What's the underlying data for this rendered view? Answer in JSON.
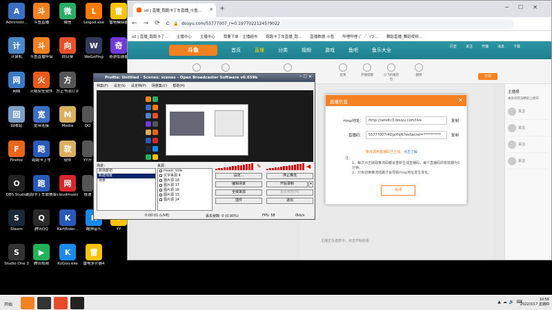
{
  "desktop": {
    "icons": [
      {
        "label": "Administr...",
        "color": "#3a6fc4",
        "glyph": "A",
        "col": 0,
        "row": 0
      },
      {
        "label": "斗鱼直播",
        "color": "#f58220",
        "glyph": "斗",
        "col": 1,
        "row": 0
      },
      {
        "label": "微信",
        "color": "#2aae67",
        "glyph": "微",
        "col": 2,
        "row": 0
      },
      {
        "label": "Leigod.exe",
        "color": "#ff7a00",
        "glyph": "L",
        "col": 3,
        "row": 0
      },
      {
        "label": "雷电模拟器",
        "color": "#f8c400",
        "glyph": "雷",
        "col": 4,
        "row": 0
      },
      {
        "label": "计算机",
        "color": "#4a86c8",
        "glyph": "计",
        "col": 0,
        "row": 1
      },
      {
        "label": "斗鱼直播伴侣",
        "color": "#f58220",
        "glyph": "斗",
        "col": 1,
        "row": 1
      },
      {
        "label": "向日葵",
        "color": "#e8502a",
        "glyph": "向",
        "col": 2,
        "row": 1
      },
      {
        "label": "WeGoPing",
        "color": "#333a5e",
        "glyph": "W",
        "col": 3,
        "row": 1
      },
      {
        "label": "奇游加速器",
        "color": "#6f3ad8",
        "glyph": "奇",
        "col": 4,
        "row": 1
      },
      {
        "label": "网络",
        "color": "#3a79c4",
        "glyph": "网",
        "col": 0,
        "row": 2
      },
      {
        "label": "火绒安全软件",
        "color": "#e85a1a",
        "glyph": "火",
        "col": 1,
        "row": 2
      },
      {
        "label": "方正书法打字",
        "color": "#555",
        "glyph": "方",
        "col": 2,
        "row": 2
      },
      {
        "label": "回收站",
        "color": "#7aa0c8",
        "glyph": "回",
        "col": 0,
        "row": 3
      },
      {
        "label": "宽带连接",
        "color": "#3a6fc4",
        "glyph": "宽",
        "col": 1,
        "row": 3
      },
      {
        "label": "Media",
        "color": "#d8b060",
        "glyph": "M",
        "col": 2,
        "row": 3
      },
      {
        "label": "Firefox",
        "color": "#e8661a",
        "glyph": "F",
        "col": 0,
        "row": 4
      },
      {
        "label": "跑跑卡丁车",
        "color": "#2a5ab8",
        "glyph": "跑",
        "col": 1,
        "row": 4
      },
      {
        "label": "软件",
        "color": "#d8b060",
        "glyph": "软",
        "col": 2,
        "row": 4
      },
      {
        "label": "OBS Studio",
        "color": "#222",
        "glyph": "O",
        "col": 0,
        "row": 5
      },
      {
        "label": "跑跑卡丁车联赛版",
        "color": "#2a5ab8",
        "glyph": "跑",
        "col": 1,
        "row": 5
      },
      {
        "label": "cloudmusic",
        "color": "#d8272a",
        "glyph": "网",
        "col": 2,
        "row": 5
      },
      {
        "label": "Steam",
        "color": "#1b2838",
        "glyph": "S",
        "col": 0,
        "row": 6
      },
      {
        "label": "腾讯QQ",
        "color": "#2a2a2a",
        "glyph": "Q",
        "col": 1,
        "row": 6
      },
      {
        "label": "KartRider...",
        "color": "#2a5ab8",
        "glyph": "K",
        "col": 2,
        "row": 6
      },
      {
        "label": "酷狗音乐",
        "color": "#1a8ae8",
        "glyph": "K",
        "col": 3,
        "row": 6
      },
      {
        "label": "YY",
        "color": "#f8c400",
        "glyph": "Y",
        "col": 4,
        "row": 6
      },
      {
        "label": "Studio One 3",
        "color": "#333",
        "glyph": "S",
        "col": 0,
        "row": 7
      },
      {
        "label": "腾讯视频",
        "color": "#21b35a",
        "glyph": "▶",
        "col": 1,
        "row": 7
      },
      {
        "label": "KuGou.exe",
        "color": "#1a8ae8",
        "glyph": "K",
        "col": 2,
        "row": 7
      },
      {
        "label": "雷电多开器4",
        "color": "#f8c400",
        "glyph": "雷",
        "col": 3,
        "row": 7
      }
    ],
    "partial_icons": [
      {
        "label": "QQ",
        "row": 3
      },
      {
        "label": "YY开",
        "row": 4
      },
      {
        "label": "极速",
        "row": 5
      }
    ]
  },
  "browser": {
    "tab_title": "s0 | 直播_跑跑卡丁车直播_斗鱼...",
    "url": "douyu.com/55777007_r=0.19770221245?9022",
    "bookmarks": [
      "s0 | 直播_跑跑卡丁...",
      "主播中心",
      "主播中心",
      "我要下单 - 主播超市",
      "跑跑卡丁车直播_跑...",
      "直播数据-斗鱼",
      "哔哩哔哩 (゜-゜)つ...",
      "舞蹈直播_舞蹈视频..."
    ]
  },
  "site": {
    "logo": "斗鱼",
    "nav": [
      "首页",
      "直播",
      "分类",
      "视频",
      "游戏",
      "鱼吧",
      "鱼乐大全"
    ],
    "nav_active": 1,
    "top_icons": [
      "历史",
      "关注",
      "开播",
      "消息",
      "下载"
    ],
    "sub_icons": [
      {
        "label": "大力支持",
        "pos": 88
      },
      {
        "label": "喜欢",
        "pos": 130
      },
      {
        "label": "主播一起玩",
        "pos": 220
      },
      {
        "label": "鱼猜",
        "pos": 300
      },
      {
        "label": "开播提醒",
        "pos": 335
      },
      {
        "label": "小飞机推荐位",
        "pos": 370
      },
      {
        "label": "翻牌",
        "pos": 410
      }
    ],
    "subscribe_label": "订阅",
    "play_tip": "主播正在连麦中，点击开始收看",
    "right_header": "主播榜",
    "right_note": "本房间玩法精彩上榜日",
    "right_rows": [
      "关注",
      "关注",
      "关注",
      "关注"
    ]
  },
  "modal": {
    "title": "直播信息",
    "rtmp_label": "rtmp地址：",
    "rtmp_value": "rtmp://sendtc3.douyu.com/live",
    "stream_label": "直播码：",
    "stream_value": "55777007r4DjaYlqN?wsSecret=**********",
    "copy_label": "复制",
    "hint": "推流调用直播码已上线，",
    "hint_link": "点击了解",
    "notes_title": "注：",
    "note1": "1、每次点击获取推流码都会重新生成直播码，每个直播码的有效期为5分钟。",
    "note2": "2、只有切换推流线路才会导致rtmp地址发生变化。",
    "close_label": "关闭"
  },
  "obs": {
    "title": "Profile: Untitled - Scenes: scenes - Open Broadcaster Software v0.659b",
    "menu": [
      "档案(F)",
      "设定(S)",
      "设定档(P)",
      "场景集(C)",
      "帮助(H)"
    ],
    "scenes_label": "场景：",
    "scenes": [
      "新场景初",
      "新建场景",
      "场景"
    ],
    "scenes_selected": 1,
    "sources_label": "来源：",
    "sources": [
      "music_title",
      "文字来源 4",
      "图片源 18",
      "图片源 17",
      "图片源 16",
      "图片源 15",
      "图片源 14"
    ],
    "buttons": {
      "settings": "设定...",
      "stop_stream": "停止推流",
      "edit_scene": "编辑场景",
      "start_record": "开始录制",
      "global_sources": "全域来源",
      "stream_preview": "视讯预览(N)",
      "plugins": "插件",
      "exit": "退出"
    },
    "status": {
      "time": "0:00:01 (LIVE)",
      "dropped": "丢失帧数: 0 (0.00%)",
      "fps": "FPS: 58",
      "bitrate": "0kb/s"
    }
  },
  "taskbar": {
    "start_label": "开始",
    "apps": [
      "#f58220",
      "#333",
      "#e84a2a",
      "#222"
    ],
    "time": "10:58",
    "date": "2022/3/17 星期四"
  }
}
